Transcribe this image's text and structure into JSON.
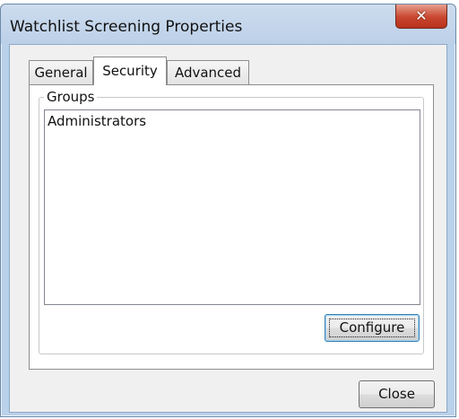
{
  "window": {
    "title": "Watchlist Screening Properties",
    "close_glyph": "✕"
  },
  "tabs": [
    {
      "label": "General",
      "selected": false
    },
    {
      "label": "Security",
      "selected": true
    },
    {
      "label": "Advanced",
      "selected": false
    }
  ],
  "security": {
    "group_label": "Groups",
    "groups": [
      "Administrators"
    ],
    "configure_label": "Configure"
  },
  "footer": {
    "close_label": "Close"
  }
}
